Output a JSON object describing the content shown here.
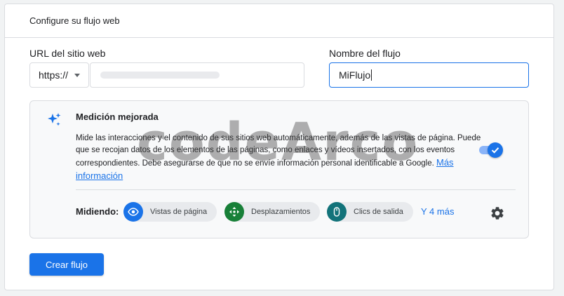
{
  "header": {
    "title": "Configure su flujo web"
  },
  "url_field": {
    "label": "URL del sitio web",
    "protocol_selected": "https://"
  },
  "name_field": {
    "label": "Nombre del flujo",
    "value": "MiFlujo"
  },
  "enhanced_measurement": {
    "icon": "sparkle-icon",
    "title": "Medición mejorada",
    "description": "Mide las interacciones y el contenido de sus sitios web automáticamente, además de las vistas de página. Puede que se recojan datos de los elementos de las páginas, como enlaces y vídeos insertados, con los eventos correspondientes. Debe asegurarse de que no se envíe información personal identificable a Google.",
    "more_info_link": "Más información",
    "toggle_on": true,
    "measuring_label": "Midiendo:",
    "chips": [
      {
        "label": "Vistas de página",
        "icon": "eye-icon",
        "color": "#1a73e8"
      },
      {
        "label": "Desplazamientos",
        "icon": "scroll-icon",
        "color": "#188038"
      },
      {
        "label": "Clics de salida",
        "icon": "mouse-icon",
        "color": "#12737a"
      }
    ],
    "more_link": "Y 4 más",
    "settings_icon": "gear-icon"
  },
  "create_button": {
    "label": "Crear flujo"
  },
  "watermark": {
    "text": "codeArco"
  },
  "colors": {
    "accent": "#1a73e8",
    "panel_bg": "#f8f9fa",
    "border": "#dadce0"
  }
}
